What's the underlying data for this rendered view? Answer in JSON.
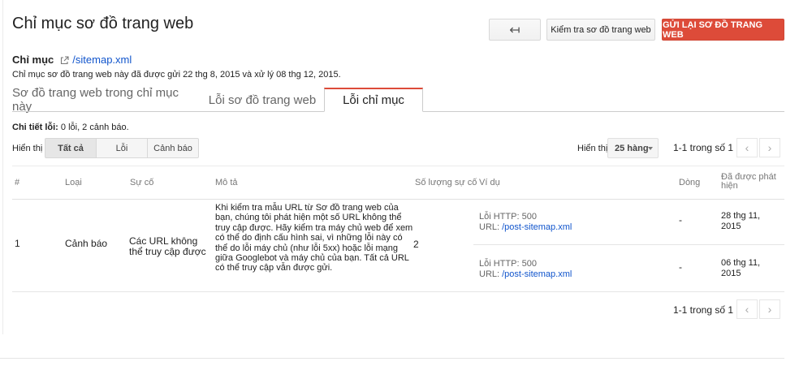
{
  "page_title": "Chỉ mục sơ đồ trang web",
  "toolbar": {
    "back_icon": "back-arrow-icon",
    "back_glyph": "↤",
    "test_label": "Kiểm tra sơ đồ trang web",
    "resubmit_label": "GỬI LẠI SƠ ĐỒ TRANG WEB"
  },
  "index": {
    "label": "Chỉ mục",
    "link": "/sitemap.xml",
    "description": "Chỉ mục sơ đồ trang web này đã được gửi 22 thg 8, 2015 và xử lý 08 thg 12, 2015."
  },
  "tabs": [
    {
      "label": "Sơ đồ trang web trong chỉ mục này"
    },
    {
      "label": "Lỗi sơ đồ trang web"
    },
    {
      "label": "Lỗi chỉ mục",
      "active": true
    }
  ],
  "details": {
    "label": "Chi tiết lỗi:",
    "value": "0 lỗi, 2 cảnh báo."
  },
  "filter": {
    "label": "Hiển thị",
    "options": [
      "Tất cả",
      "Lỗi",
      "Cảnh báo"
    ],
    "selected": "Tất cả"
  },
  "rows_per_page": {
    "label": "Hiển thị",
    "value": "25 hàng"
  },
  "pager": {
    "text": "1-1 trong số 1",
    "prev_glyph": "‹",
    "next_glyph": "›"
  },
  "table": {
    "headers": [
      "#",
      "Loại",
      "Sự cố",
      "Mô tả",
      "Số lượng sự cố",
      "Ví dụ",
      "Dòng",
      "Đã được phát hiện"
    ],
    "rows": [
      {
        "num": "1",
        "type": "Cảnh báo",
        "issue": "Các URL không thể truy cập được",
        "description": "Khi kiểm tra mẫu URL từ Sơ đồ trang web của bạn, chúng tôi phát hiện một số URL không thể truy cập được. Hãy kiểm tra máy chủ web để xem có thể do định cấu hình sai, vì những lỗi này có thể do lỗi máy chủ (như lỗi 5xx) hoặc lỗi mạng giữa Googlebot và máy chủ của bạn. Tất cả URL có thể truy cập vẫn được gửi.",
        "count": "2",
        "examples": [
          {
            "http_label": "Lỗi HTTP:",
            "http_code": "500",
            "url_label": "URL:",
            "url": "/post-sitemap.xml",
            "line": "-",
            "detected": "28 thg 11, 2015"
          },
          {
            "http_label": "Lỗi HTTP:",
            "http_code": "500",
            "url_label": "URL:",
            "url": "/post-sitemap.xml",
            "line": "-",
            "detected": "06 thg 11, 2015"
          }
        ]
      }
    ]
  },
  "colors": {
    "accent_red": "#dd4b39",
    "link_blue": "#1155cc"
  }
}
